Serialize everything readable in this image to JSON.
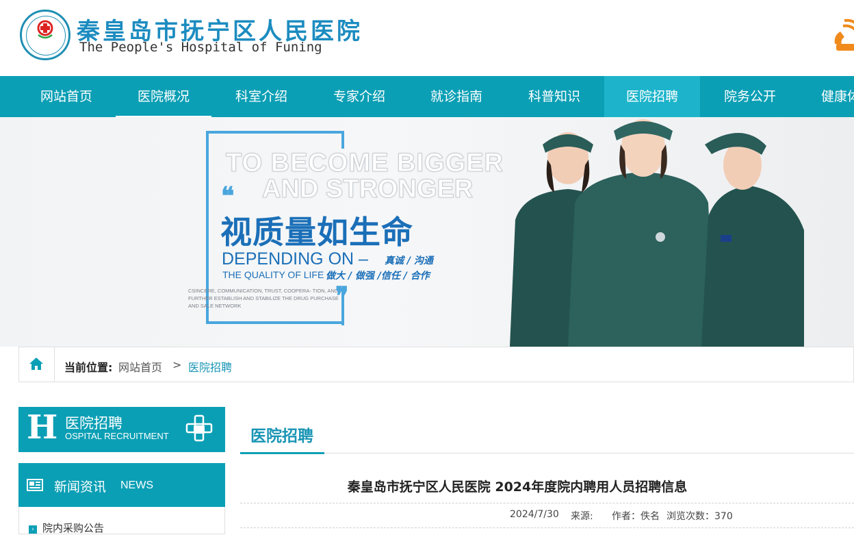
{
  "header": {
    "logo_cn": "秦皇岛市抚宁区人民医院",
    "logo_en": "The People's Hospital of Funing",
    "brand_color": "#0b9fb5"
  },
  "nav": {
    "items": [
      {
        "label": "网站首页"
      },
      {
        "label": "医院概况"
      },
      {
        "label": "科室介绍"
      },
      {
        "label": "专家介绍"
      },
      {
        "label": "就诊指南"
      },
      {
        "label": "科普知识"
      },
      {
        "label": "医院招聘"
      },
      {
        "label": "院务公开"
      },
      {
        "label": "健康体"
      }
    ],
    "active": "医院招聘"
  },
  "banner": {
    "headline_1": "TO BECOME BIGGER",
    "headline_2": "AND STRONGER",
    "slogan_cn": "视质量如生命",
    "depending": "DEPENDING ON –",
    "depending_cn": "真诚 / 沟通",
    "quality": "THE QUALITY OF LIFE",
    "quality_cn": "做大 / 做强 /信任 / 合作",
    "small_text": "CSINCERE, COMMUNICATION, TRUST, COOPERA- TION, AND FURTHER ESTABLISH AND STABILIZE THE DRUG PURCHASE AND SALE NETWORK"
  },
  "breadcrumb": {
    "label": "当前位置:",
    "home": "网站首页",
    "separator": ">",
    "current": "医院招聘"
  },
  "sidebar": {
    "title_letter": "H",
    "title_cn": "医院招聘",
    "title_en": "OSPITAL RECRUITMENT",
    "news_cn": "新闻资讯",
    "news_en": "NEWS",
    "list": [
      {
        "label": "院内采购公告"
      }
    ]
  },
  "main": {
    "tab": "医院招聘",
    "article_title": "秦皇岛市抚宁区人民医院 2024年度院内聘用人员招聘信息",
    "date": "2024/7/30",
    "source": "来源:",
    "author": "作者：佚名",
    "views": "浏览次数：370"
  }
}
